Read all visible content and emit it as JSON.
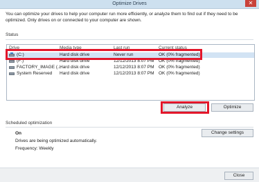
{
  "window": {
    "title": "Optimize Drives",
    "close_glyph": "✕"
  },
  "intro_text": "You can optimize your drives to help your computer run more efficiently, or analyze them to find out if they need to be optimized. Only drives on or connected to your computer are shown.",
  "status": {
    "section_label": "Status",
    "columns": [
      "Drive",
      "Media type",
      "Last run",
      "Current status"
    ],
    "drives": [
      {
        "name": "(C:)",
        "media": "Hard disk drive",
        "last_run": "Never run",
        "status": "OK (0% fragmented)",
        "icon": "os-drive-icon",
        "selected": true
      },
      {
        "name": "(F:)",
        "media": "Hard disk drive",
        "last_run": "12/12/2013 8:07 PM",
        "status": "OK (0% fragmented)",
        "icon": "hard-drive-icon",
        "selected": false
      },
      {
        "name": "FACTORY_IMAGE (...",
        "media": "Hard disk drive",
        "last_run": "12/12/2013 8:07 PM",
        "status": "OK (0% fragmented)",
        "icon": "hard-drive-icon",
        "selected": false
      },
      {
        "name": "System Reserved",
        "media": "Hard disk drive",
        "last_run": "12/12/2013 8:07 PM",
        "status": "OK (0% fragmented)",
        "icon": "hard-drive-icon",
        "selected": false
      }
    ],
    "analyze_label": "Analyze",
    "optimize_label": "Optimize"
  },
  "scheduled": {
    "section_label": "Scheduled optimization",
    "state": "On",
    "description": "Drives are being optimized automatically.",
    "frequency": "Frequency: Weekly",
    "change_settings_label": "Change settings"
  },
  "footer": {
    "close_label": "Close"
  },
  "colors": {
    "highlight": "#e3162a",
    "selected_row": "#d2e3f4",
    "titlebar": "#cde0ef",
    "close_button": "#c9423a"
  }
}
